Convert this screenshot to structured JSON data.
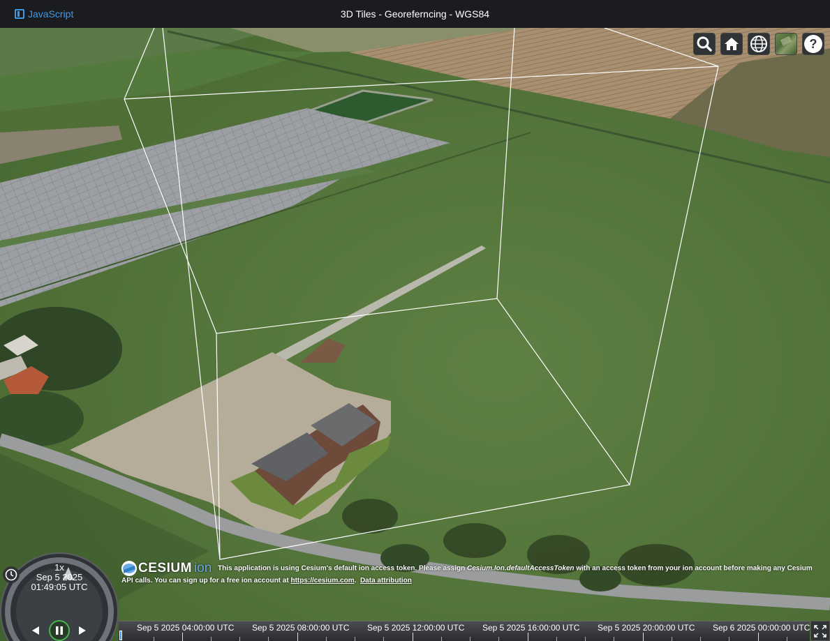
{
  "header": {
    "language_link": "JavaScript",
    "title": "3D Tiles - Georeferncing - WGS84"
  },
  "colors": {
    "accent": "#3d99e6",
    "toolbar_bg": "#303336",
    "play_active": "#48b34a"
  },
  "toolbar": {
    "buttons": [
      "search-icon",
      "home-icon",
      "globe-icon",
      "imagery-layer-icon",
      "help-icon"
    ]
  },
  "credits": {
    "logo_word": "CESIUM",
    "logo_suffix": "ion",
    "message_start": "This application is using Cesium's default ion access token. Please assign ",
    "message_code": "Cesium.Ion.defaultAccessToken",
    "message_end": " with an access token from your ion account before making any Cesium API calls. You can sign up for a free ion account at ",
    "signup_link": "https://cesium.com",
    "period": ".",
    "attribution_link": "Data attribution"
  },
  "animation": {
    "speed": "1x",
    "date": "Sep 5 2025",
    "time": "01:49:05 UTC",
    "state": "paused"
  },
  "timeline": {
    "labels": [
      "Sep 5 2025 04:00:00 UTC",
      "Sep 5 2025 08:00:00 UTC",
      "Sep 5 2025 12:00:00 UTC",
      "Sep 5 2025 16:00:00 UTC",
      "Sep 5 2025 20:00:00 UTC",
      "Sep 6 2025 00:00:00 UTC"
    ]
  }
}
